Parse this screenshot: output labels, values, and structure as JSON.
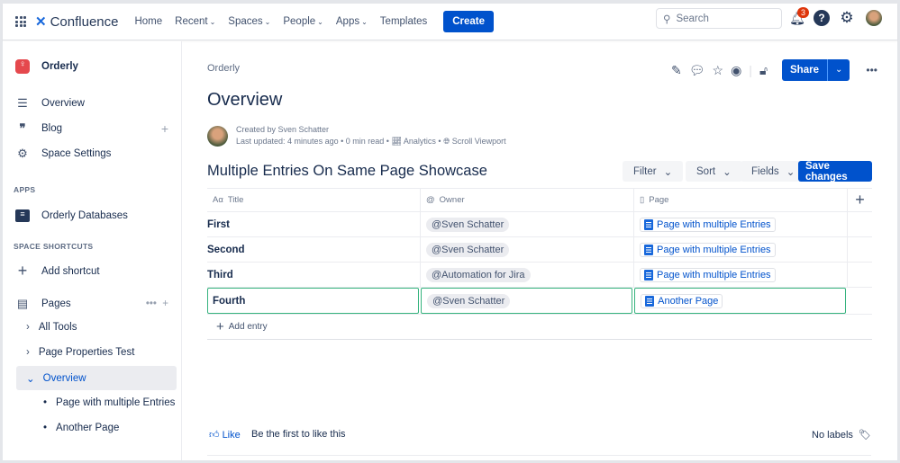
{
  "topnav": {
    "product": "Confluence",
    "items": [
      {
        "label": "Home",
        "dropdown": false
      },
      {
        "label": "Recent",
        "dropdown": true
      },
      {
        "label": "Spaces",
        "dropdown": true
      },
      {
        "label": "People",
        "dropdown": true
      },
      {
        "label": "Apps",
        "dropdown": true
      },
      {
        "label": "Templates",
        "dropdown": false
      }
    ],
    "create": "Create",
    "search_placeholder": "Search",
    "notifications": "3"
  },
  "sidebar": {
    "space": "Orderly",
    "items": [
      "Overview",
      "Blog",
      "Space Settings"
    ],
    "apps_header": "APPS",
    "apps": [
      "Orderly Databases"
    ],
    "shortcuts_header": "SPACE SHORTCUTS",
    "add_shortcut": "Add shortcut",
    "pages_label": "Pages",
    "tree": [
      "All Tools",
      "Page Properties Test",
      "Overview",
      "Page with multiple Entries",
      "Another Page"
    ]
  },
  "page": {
    "breadcrumb": "Orderly",
    "title": "Overview",
    "created_by": "Created by Sven Schatter",
    "last_updated": "Last updated: 4 minutes ago",
    "read_time": "0 min read",
    "analytics": "Analytics",
    "viewport": "Scroll Viewport",
    "share": "Share"
  },
  "database": {
    "title": "Multiple Entries On Same Page Showcase",
    "filter": "Filter",
    "sort": "Sort",
    "fields": "Fields",
    "save": "Save changes",
    "columns": [
      {
        "icon": "Aα",
        "label": "Title"
      },
      {
        "icon": "@",
        "label": "Owner"
      },
      {
        "icon": "page",
        "label": "Page"
      }
    ],
    "rows": [
      {
        "title": "First",
        "owner": "@Sven Schatter",
        "page": "Page with multiple Entries"
      },
      {
        "title": "Second",
        "owner": "@Sven Schatter",
        "page": "Page with multiple Entries"
      },
      {
        "title": "Third",
        "owner": "@Automation for Jira",
        "page": "Page with multiple Entries"
      },
      {
        "title": "Fourth",
        "owner": "@Sven Schatter",
        "page": "Another Page"
      }
    ],
    "add_entry": "Add entry"
  },
  "footer": {
    "like": "Like",
    "like_text": "Be the first to like this",
    "labels": "No labels"
  },
  "colors": {
    "primary": "#0052cc",
    "selected_border": "#36b37e",
    "badge": "#de350b"
  }
}
